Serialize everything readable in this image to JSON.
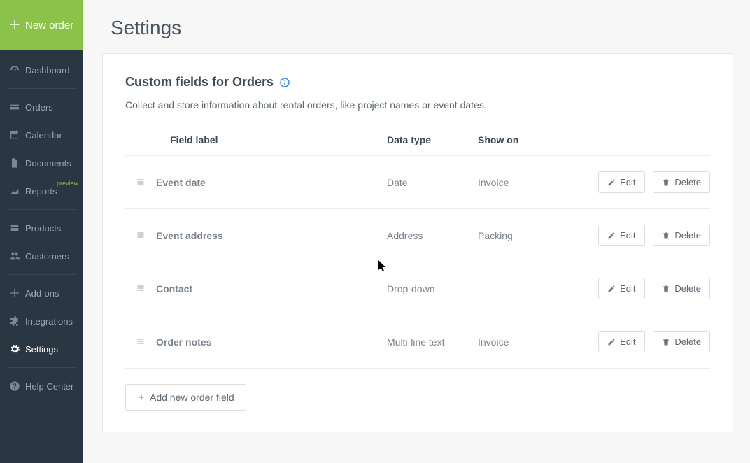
{
  "sidebar": {
    "new_order": "New order",
    "items": [
      {
        "label": "Dashboard"
      },
      {
        "label": "Orders"
      },
      {
        "label": "Calendar"
      },
      {
        "label": "Documents"
      },
      {
        "label": "Reports",
        "badge": "preview"
      },
      {
        "label": "Products"
      },
      {
        "label": "Customers"
      },
      {
        "label": "Add-ons"
      },
      {
        "label": "Integrations"
      },
      {
        "label": "Settings"
      },
      {
        "label": "Help Center"
      }
    ]
  },
  "page": {
    "title": "Settings"
  },
  "card": {
    "title": "Custom fields for Orders",
    "subtitle": "Collect and store information about rental orders, like project names or event dates.",
    "headers": {
      "label": "Field label",
      "type": "Data type",
      "show": "Show on"
    },
    "rows": [
      {
        "label": "Event date",
        "type": "Date",
        "show": "Invoice"
      },
      {
        "label": "Event address",
        "type": "Address",
        "show": "Packing"
      },
      {
        "label": "Contact",
        "type": "Drop-down",
        "show": ""
      },
      {
        "label": "Order notes",
        "type": "Multi-line text",
        "show": "Invoice"
      }
    ],
    "buttons": {
      "edit": "Edit",
      "delete": "Delete",
      "add": "Add new order field"
    }
  }
}
